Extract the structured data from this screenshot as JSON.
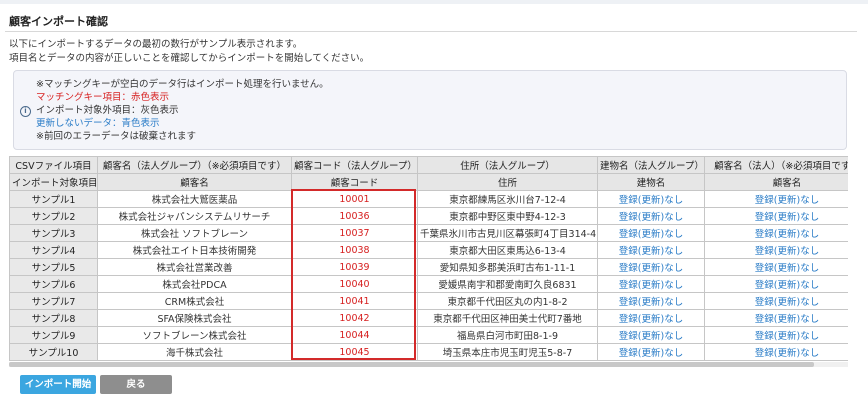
{
  "page": {
    "title": "顧客インポート確認",
    "intro": [
      "以下にインポートするデータの最初の数行がサンプル表示されます。",
      "項目名とデータの内容が正しいことを確認してからインポートを開始してください。"
    ]
  },
  "notice": {
    "icon": "info-icon",
    "lines": [
      "※マッチングキーが空白のデータ行はインポート処理を行いません。",
      "マッチングキー項目：赤色表示",
      "インポート対象外項目：灰色表示",
      "更新しないデータ：青色表示",
      "※前回のエラーデータは破棄されます"
    ]
  },
  "table": {
    "header_csv": [
      "CSVファイル項目",
      "顧客名（法人グループ）（※必須項目です）",
      "顧客コード（法人グループ）",
      "住所（法人グループ）",
      "建物名（法人グループ）",
      "顧客名（法人）（※必須項目です）"
    ],
    "header_target": [
      "インポート対象項目",
      "顧客名",
      "顧客コード",
      "住所",
      "建物名",
      "顧客名"
    ],
    "rows": [
      {
        "label": "サンプル1",
        "name": "株式会社大鷲医薬品",
        "code": "10001",
        "address": "東京都練馬区氷川台7-12-4",
        "building": "登録(更新)なし",
        "corp_name": "登録(更新)なし"
      },
      {
        "label": "サンプル2",
        "name": "株式会社ジャパンシステムリサーチ",
        "code": "10036",
        "address": "東京都中野区東中野4-12-3",
        "building": "登録(更新)なし",
        "corp_name": "登録(更新)なし"
      },
      {
        "label": "サンプル3",
        "name": "株式会社 ソフトブレーン",
        "code": "10037",
        "address": "千葉県氷川市古見川区幕張町4丁目314-4",
        "building": "登録(更新)なし",
        "corp_name": "登録(更新)なし"
      },
      {
        "label": "サンプル4",
        "name": "株式会社エイト日本技術開発",
        "code": "10038",
        "address": "東京都大田区東馬込6-13-4",
        "building": "登録(更新)なし",
        "corp_name": "登録(更新)なし"
      },
      {
        "label": "サンプル5",
        "name": "株式会社営業改善",
        "code": "10039",
        "address": "愛知県知多郡美浜町古布1-11-1",
        "building": "登録(更新)なし",
        "corp_name": "登録(更新)なし"
      },
      {
        "label": "サンプル6",
        "name": "株式会社PDCA",
        "code": "10040",
        "address": "愛媛県南宇和郡愛南町久良6831",
        "building": "登録(更新)なし",
        "corp_name": "登録(更新)なし"
      },
      {
        "label": "サンプル7",
        "name": "CRM株式会社",
        "code": "10041",
        "address": "東京都千代田区丸の内1-8-2",
        "building": "登録(更新)なし",
        "corp_name": "登録(更新)なし"
      },
      {
        "label": "サンプル8",
        "name": "SFA保険株式会社",
        "code": "10042",
        "address": "東京都千代田区神田美士代町7番地",
        "building": "登録(更新)なし",
        "corp_name": "登録(更新)なし"
      },
      {
        "label": "サンプル9",
        "name": "ソフトブレーン株式会社",
        "code": "10044",
        "address": "福島県白河市町田8-1-9",
        "building": "登録(更新)なし",
        "corp_name": "登録(更新)なし"
      },
      {
        "label": "サンプル10",
        "name": "海千株式会社",
        "code": "10045",
        "address": "埼玉県本庄市児玉町児玉5-8-7",
        "building": "登録(更新)なし",
        "corp_name": "登録(更新)なし"
      }
    ]
  },
  "buttons": {
    "import": "インポート開始",
    "back": "戻る"
  },
  "colors": {
    "matching_key": "#d61f1f",
    "no_update": "#2a7cc7",
    "import_button": "#3ba6e0",
    "back_button": "#8e8e8e"
  }
}
